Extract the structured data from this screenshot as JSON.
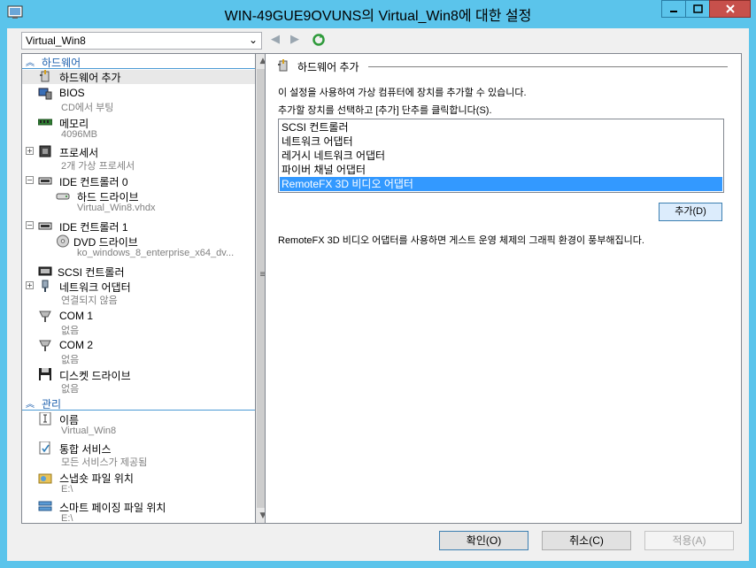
{
  "window": {
    "title": "WIN-49GUE9OVUNS의 Virtual_Win8에 대한 설정"
  },
  "toolbar": {
    "vm_selector_value": "Virtual_Win8",
    "back_icon": "back-arrow-icon",
    "forward_icon": "forward-arrow-icon",
    "refresh_icon": "refresh-icon"
  },
  "tree": {
    "hardware_section": "하드웨어",
    "hardware": [
      {
        "label": "하드웨어 추가",
        "sub": "",
        "icon": "add-hardware-icon",
        "selected": true
      },
      {
        "label": "BIOS",
        "sub": "CD에서 부팅",
        "icon": "bios-icon"
      },
      {
        "label": "메모리",
        "sub": "4096MB",
        "icon": "memory-icon"
      },
      {
        "label": "프로세서",
        "sub": "2개 가상 프로세서",
        "icon": "processor-icon",
        "expander": "+"
      },
      {
        "label": "IDE 컨트롤러 0",
        "sub": "",
        "icon": "ide-controller-icon",
        "expander": "-"
      },
      {
        "label": "하드 드라이브",
        "sub": "Virtual_Win8.vhdx",
        "icon": "hard-drive-icon"
      },
      {
        "label": "IDE 컨트롤러 1",
        "sub": "",
        "icon": "ide-controller-icon",
        "expander": "-"
      },
      {
        "label": "DVD 드라이브",
        "sub": "ko_windows_8_enterprise_x64_dv...",
        "icon": "dvd-drive-icon"
      },
      {
        "label": "SCSI 컨트롤러",
        "sub": "",
        "icon": "scsi-controller-icon"
      },
      {
        "label": "네트워크 어댑터",
        "sub": "연결되지 않음",
        "icon": "network-adapter-icon",
        "expander": "+"
      },
      {
        "label": "COM 1",
        "sub": "없음",
        "icon": "com-port-icon"
      },
      {
        "label": "COM 2",
        "sub": "없음",
        "icon": "com-port-icon"
      },
      {
        "label": "디스켓 드라이브",
        "sub": "없음",
        "icon": "floppy-drive-icon"
      }
    ],
    "management_section": "관리",
    "management": [
      {
        "label": "이름",
        "sub": "Virtual_Win8",
        "icon": "name-icon"
      },
      {
        "label": "통합 서비스",
        "sub": "모든 서비스가 제공됨",
        "icon": "integration-services-icon"
      },
      {
        "label": "스냅숏 파일 위치",
        "sub": "E:\\",
        "icon": "snapshot-location-icon"
      },
      {
        "label": "스마트 페이징 파일 위치",
        "sub": "E:\\",
        "icon": "smart-paging-icon"
      }
    ]
  },
  "panel": {
    "header": "하드웨어 추가",
    "intro": "이 설정을 사용하여 가상 컴퓨터에 장치를 추가할 수 있습니다.",
    "instruction": "추가할 장치를 선택하고 [추가] 단추를 클릭합니다(S).",
    "devices": [
      {
        "label": "SCSI 컨트롤러",
        "selected": false
      },
      {
        "label": "네트워크 어댑터",
        "selected": false
      },
      {
        "label": "레거시 네트워크 어댑터",
        "selected": false
      },
      {
        "label": "파이버 채널 어댑터",
        "selected": false
      },
      {
        "label": "RemoteFX 3D 비디오 어댑터",
        "selected": true
      }
    ],
    "add_button": "추가(D)",
    "description": "RemoteFX 3D 비디오 어댑터를 사용하면 게스트 운영 체제의 그래픽 환경이 풍부해집니다."
  },
  "buttons": {
    "ok": "확인(O)",
    "cancel": "취소(C)",
    "apply": "적용(A)"
  },
  "colors": {
    "title_bar": "#5bc4eb",
    "selection": "#3399ff",
    "section_text": "#1d60ad",
    "close_button": "#c7504b"
  }
}
